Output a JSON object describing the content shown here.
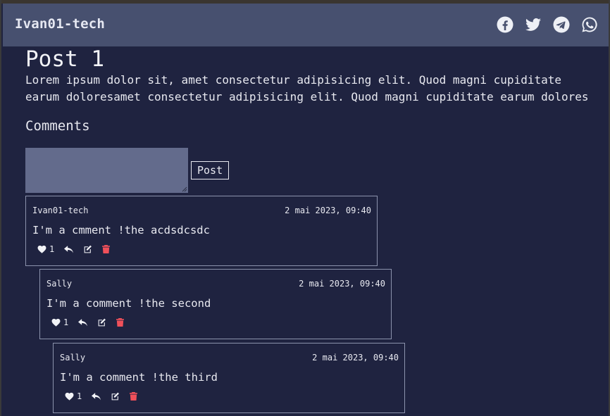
{
  "app": {
    "brand": "Ivan01-tech"
  },
  "social_icons": [
    "facebook-icon",
    "twitter-icon",
    "telegram-icon",
    "whatsapp-icon"
  ],
  "post": {
    "title": "Post 1",
    "body": "Lorem ipsum dolor sit, amet consectetur adipisicing elit. Quod magni cupiditate earum doloresamet consectetur adipisicing elit. Quod magni cupiditate earum dolores"
  },
  "comments_section": {
    "heading": "Comments",
    "input_value": "",
    "post_button_label": "Post"
  },
  "comments": [
    {
      "author": "Ivan01-tech",
      "date": "2 mai 2023, 09:40",
      "text": "I'm a cmment !the acdsdcsdc",
      "likes": "1",
      "depth": 0
    },
    {
      "author": "Sally",
      "date": "2 mai 2023, 09:40",
      "text": "I'm a comment !the second",
      "likes": "1",
      "depth": 1
    },
    {
      "author": "Sally",
      "date": "2 mai 2023, 09:40",
      "text": "I'm a comment !the third",
      "likes": "1",
      "depth": 2
    }
  ],
  "colors": {
    "header_bg": "#47506f",
    "page_bg": "#1f2340",
    "input_bg": "#636b8c",
    "delete_red": "#f0505a",
    "text": "#e8e9f0"
  }
}
